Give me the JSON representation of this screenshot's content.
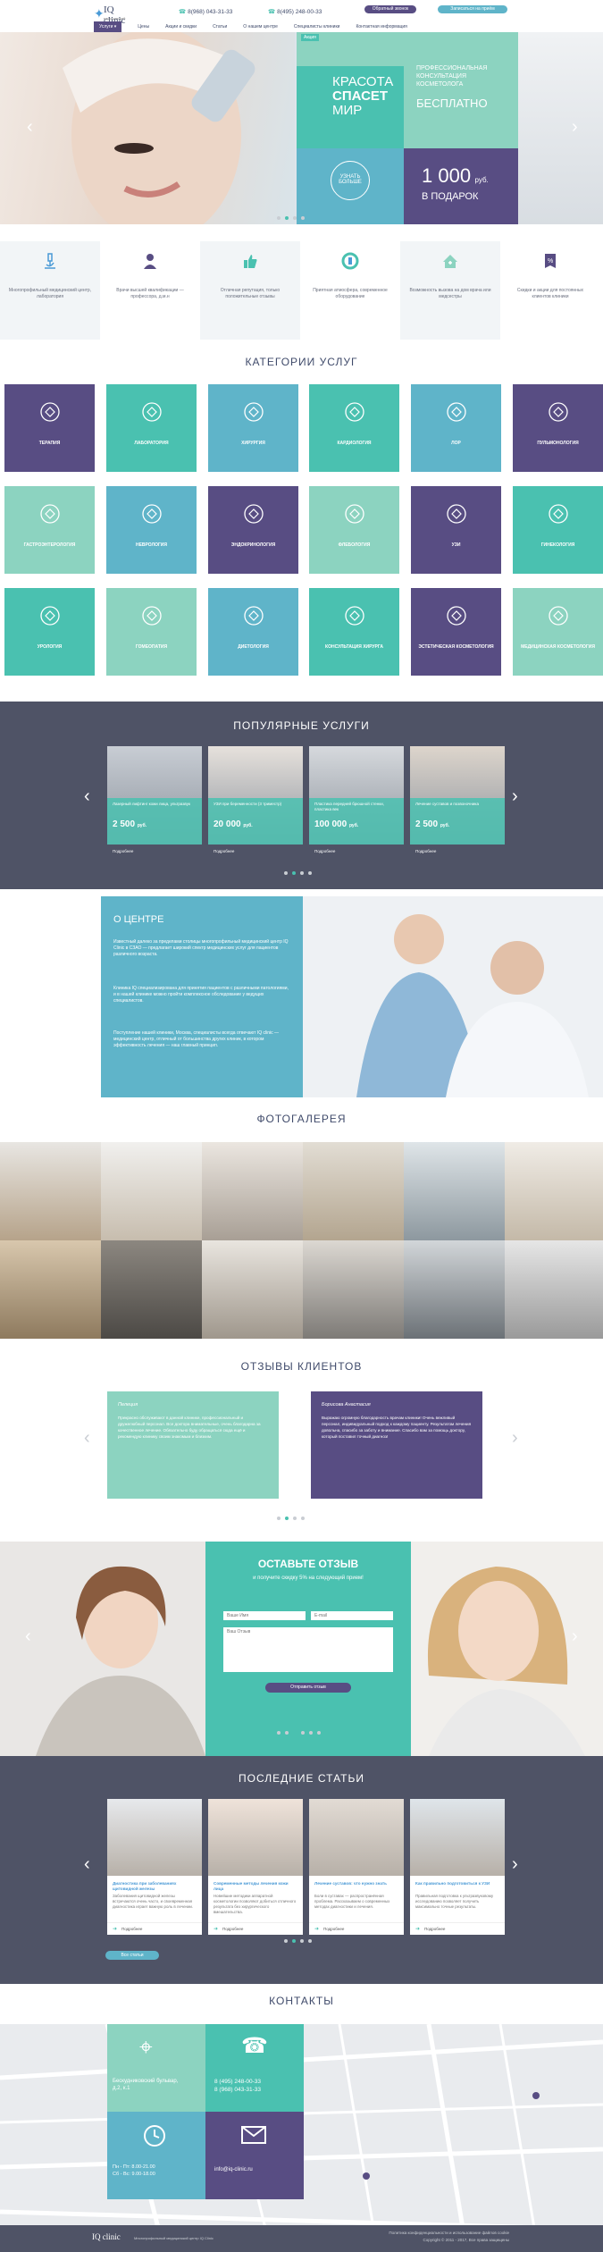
{
  "header": {
    "logo_name": "IQ clinic",
    "logo_sub": "медицинский центр",
    "phone1": "8(968) 043-31-33",
    "phone2": "8(495) 248-00-33",
    "callback": "Обратный звонок",
    "online": "Записаться на приём",
    "nav": [
      "Услуги",
      "Цены",
      "Акции и скидки",
      "Статьи",
      "О нашем центре",
      "Специалисты клиники",
      "Контактная информация"
    ]
  },
  "hero": {
    "tag": "Акция",
    "slogan_line1": "Красота",
    "slogan_line2": "спасет",
    "slogan_line3": "мир",
    "promo_line1": "Профессиональная",
    "promo_line2": "консультация",
    "promo_line3": "косметолога",
    "free": "бесплатно",
    "more": "Узнать больше",
    "price": "1 000",
    "currency": "руб.",
    "gift": "в подарок"
  },
  "features": [
    "Многопрофильный медицинский центр, лаборатория",
    "Врачи высшей квалификации — профессора, д.м.н",
    "Отличная репутация, только положительные отзывы",
    "Приятная атмосфера, современное оборудование",
    "Возможность вызова на дом врача или медсестры",
    "Скидки и акции для постоянных клиентов клиники"
  ],
  "categories_title": "Категории услуг",
  "categories": [
    "Терапия",
    "Лаборатория",
    "Хирургия",
    "Кардиология",
    "ЛОР",
    "Пульмонология",
    "Гастроэнтерология",
    "Неврология",
    "Эндокринология",
    "Флебология",
    "УЗИ",
    "Гинекология",
    "Урология",
    "Гомеопатия",
    "Диетология",
    "Консультация хирурга",
    "Эстетическая косметология",
    "Медицинская косметология"
  ],
  "popular_title": "Популярные услуги",
  "popular": [
    {
      "title": "Лазерный лифтинг кожи лица, ультразвук",
      "price": "2 500",
      "cur": "руб.",
      "more": "Подробнее"
    },
    {
      "title": "УЗИ при беременности (3 триместр)",
      "price": "20 000",
      "cur": "руб.",
      "more": "Подробнее"
    },
    {
      "title": "Пластика передней брюшной стенки, пластика век",
      "price": "100 000",
      "cur": "руб.",
      "more": "Подробнее"
    },
    {
      "title": "Лечение суставов и позвоночника",
      "price": "2 500",
      "cur": "руб.",
      "more": "Подробнее"
    }
  ],
  "about": {
    "title": "О центре",
    "p1": "Известный далеко за пределами столицы многопрофильный медицинский центр IQ Clinic в СЗАО — предлагает широкий спектр медицинских услуг для пациентов различного возраста.",
    "p2": "Клиника IQ специализирована для принятия пациентов с различными патологиями, и в нашей клинике можно пройти комплексное обследование у ведущих специалистов.",
    "p3": "Поступление нашей клиники, Москва, специалисты всегда отвечают IQ clinic — медицинский центр, отличный от большинства других клиник, в котором эффективность лечения — наш главный принцип."
  },
  "gallery_title": "Фотогалерея",
  "reviews_title": "Отзывы клиентов",
  "reviews": [
    {
      "name": "Пелеция",
      "text": "Прекрасно обслуживают в данной клинике, профессиональный и дружелюбный персонал. Все доктора внимательные, очень благодарна за качественное лечение. Обязательно буду обращаться сюда ещё и рекомендую клинику своим знакомым и близким."
    },
    {
      "name": "Борисова Анастасия",
      "text": "Выражаю огромную благодарность врачам клиники! Очень вежливый персонал, индивидуальный подход к каждому пациенту. Результатом лечения довольна, спасибо за заботу и внимание. Спасибо вам за помощь доктору, который поставил точный диагноз!"
    }
  ],
  "form": {
    "title": "Оставьте отзыв",
    "sub": "и получите скидку 5% на следующий прием!",
    "name_ph": "Ваше Имя",
    "email_ph": "E-mail",
    "text_ph": "Ваш Отзыв",
    "submit": "Отправить отзыв"
  },
  "articles_title": "Последние статьи",
  "articles": [
    {
      "title": "Диагностика при заболеваниях щитовидной железы",
      "text": "Заболевания щитовидной железы встречаются очень часто, и своевременная диагностика играет важную роль в лечении.",
      "more": "Подробнее"
    },
    {
      "title": "Современные методы лечения кожи лица",
      "text": "Новейшие методики аппаратной косметологии позволяют добиться отличного результата без хирургического вмешательства.",
      "more": "Подробнее"
    },
    {
      "title": "Лечение суставов: что нужно знать",
      "text": "Боли в суставах — распространённая проблема. Рассказываем о современных методах диагностики и лечения.",
      "more": "Подробнее"
    },
    {
      "title": "Как правильно подготовиться к УЗИ",
      "text": "Правильная подготовка к ультразвуковому исследованию позволяет получить максимально точные результаты.",
      "more": "Подробнее"
    }
  ],
  "all_articles": "Все статьи",
  "contacts": {
    "title": "Контакты",
    "address1": "Бескудниковский бульвар,",
    "address2": "д.2, к.1",
    "phone1": "8 (495) 248-00-33",
    "phone2": "8 (968) 043-31-33",
    "hours1": "Пн - Пт: 8.00-21.00",
    "hours2": "Сб - Вс: 9.00-18.00",
    "email": "info@iq-clinic.ru"
  },
  "footer": {
    "left": "Многопрофильный медицинский центр IQ Clinic",
    "right": "Политика конфиденциальности и использование файлов cookie",
    "copy": "Copyright © 2011 - 2017, Все права защищены"
  },
  "colors": {
    "purple": "#584d83",
    "teal": "#4ac1b0",
    "mint": "#8cd3c0",
    "sky": "#5fb4c9",
    "dark": "#4f5366"
  }
}
